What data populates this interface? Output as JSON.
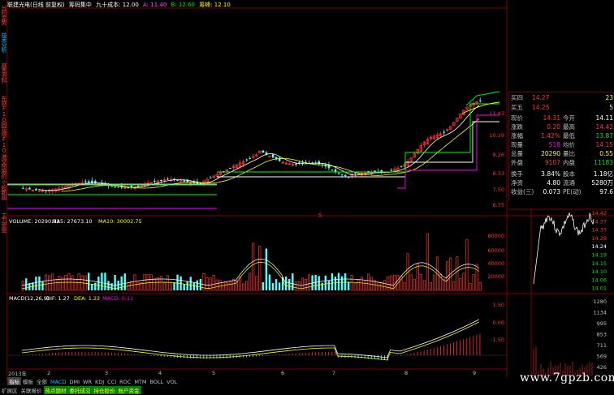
{
  "header": {
    "title": "联建光电(日线 前复权)",
    "indicator": "筹码集中",
    "cost_label": "九十成本: 12.00",
    "a_label": "A: 11.40",
    "b_label": "B: 12.60",
    "peak_label": "筹峰: 12.10"
  },
  "left_tabs": [
    "分时走势",
    "技术分析",
    "基本资料",
    "东财F10",
    "同花顺F10",
    "港交所报价",
    "个股新闻",
    "主力资金"
  ],
  "price_axis": [
    "11.43",
    "10.29",
    "9.26",
    "8.33",
    "7.50",
    "6.75"
  ],
  "volume_axis": [
    "80000",
    "60000",
    "40000",
    "20000"
  ],
  "macd_axis": [
    "1.50",
    "0.00",
    "-1.50"
  ],
  "x_axis": {
    "months": [
      "2",
      "3",
      "4",
      "5",
      "6",
      "7",
      "8",
      "9"
    ],
    "year": "2013年"
  },
  "volume_header": {
    "volume": "VOLUME: 20290.32",
    "ma5": "MA5: 27673.10",
    "ma10": "MA10: 30002.75"
  },
  "macd_header": {
    "params": "MACD(12,26,9)",
    "dif": "DIF: 1.27",
    "dea": "DEA: 1.22",
    "macd": "MACD: 0.11"
  },
  "quote": {
    "rows": [
      {
        "label": "买四",
        "v1": "14.27",
        "v2": "23"
      },
      {
        "label": "买五",
        "v1": "14.25",
        "v2": "5"
      },
      {
        "label": "现价",
        "v1": "14.31",
        "l2": "今开",
        "v2": "14.11"
      },
      {
        "label": "涨跌",
        "v1": "0.20",
        "l2": "最高",
        "v2": "14.42"
      },
      {
        "label": "涨幅",
        "v1": "1.42%",
        "l2": "最低",
        "v2": "13.87"
      },
      {
        "label": "现量",
        "v1": "518",
        "l2": "均价",
        "v2": "14.15"
      },
      {
        "label": "总量",
        "v1": "20290",
        "l2": "量比",
        "v2": "0.55"
      },
      {
        "label": "外盘",
        "v1": "9107",
        "l2": "内盘",
        "v2": "11183"
      },
      {
        "label": "换手",
        "v1": "3.84%",
        "l2": "股本",
        "v2": "1.18亿"
      },
      {
        "label": "净资",
        "v1": "4.80",
        "l2": "流通",
        "v2": "5280万"
      },
      {
        "label": "收益(三)",
        "v1": "0.073",
        "l2": "PE(动)",
        "v2": "97.6"
      }
    ]
  },
  "mini_axis": {
    "price": [
      "14.42",
      "14.37",
      "14.33",
      "14.28",
      "14.24",
      "14.19",
      "14.15",
      "14.10",
      "14.06",
      "14.01"
    ],
    "volume": [
      "1280",
      "1134",
      "995",
      "853",
      "711",
      "569",
      "426"
    ]
  },
  "tabs_row1": [
    "指标",
    "模板",
    "全部",
    "MACD",
    "DMI",
    "WR",
    "KDJ",
    "CCI",
    "ROC",
    "MTM",
    "BOLL",
    "VOL"
  ],
  "tabs_row2": [
    "扩展区",
    "关联报价",
    "热点题材",
    "委托成交",
    "持仓股份",
    "账户资金"
  ],
  "watermark": "www.7gpzb.com",
  "marker": "S",
  "colors": {
    "up": "#ff3232",
    "down": "#54ffff",
    "ma_white": "#ffffff",
    "ma_yellow": "#ffff00",
    "ma_green": "#00ff00",
    "ma_magenta": "#ff00ff",
    "border": "#800000"
  }
}
